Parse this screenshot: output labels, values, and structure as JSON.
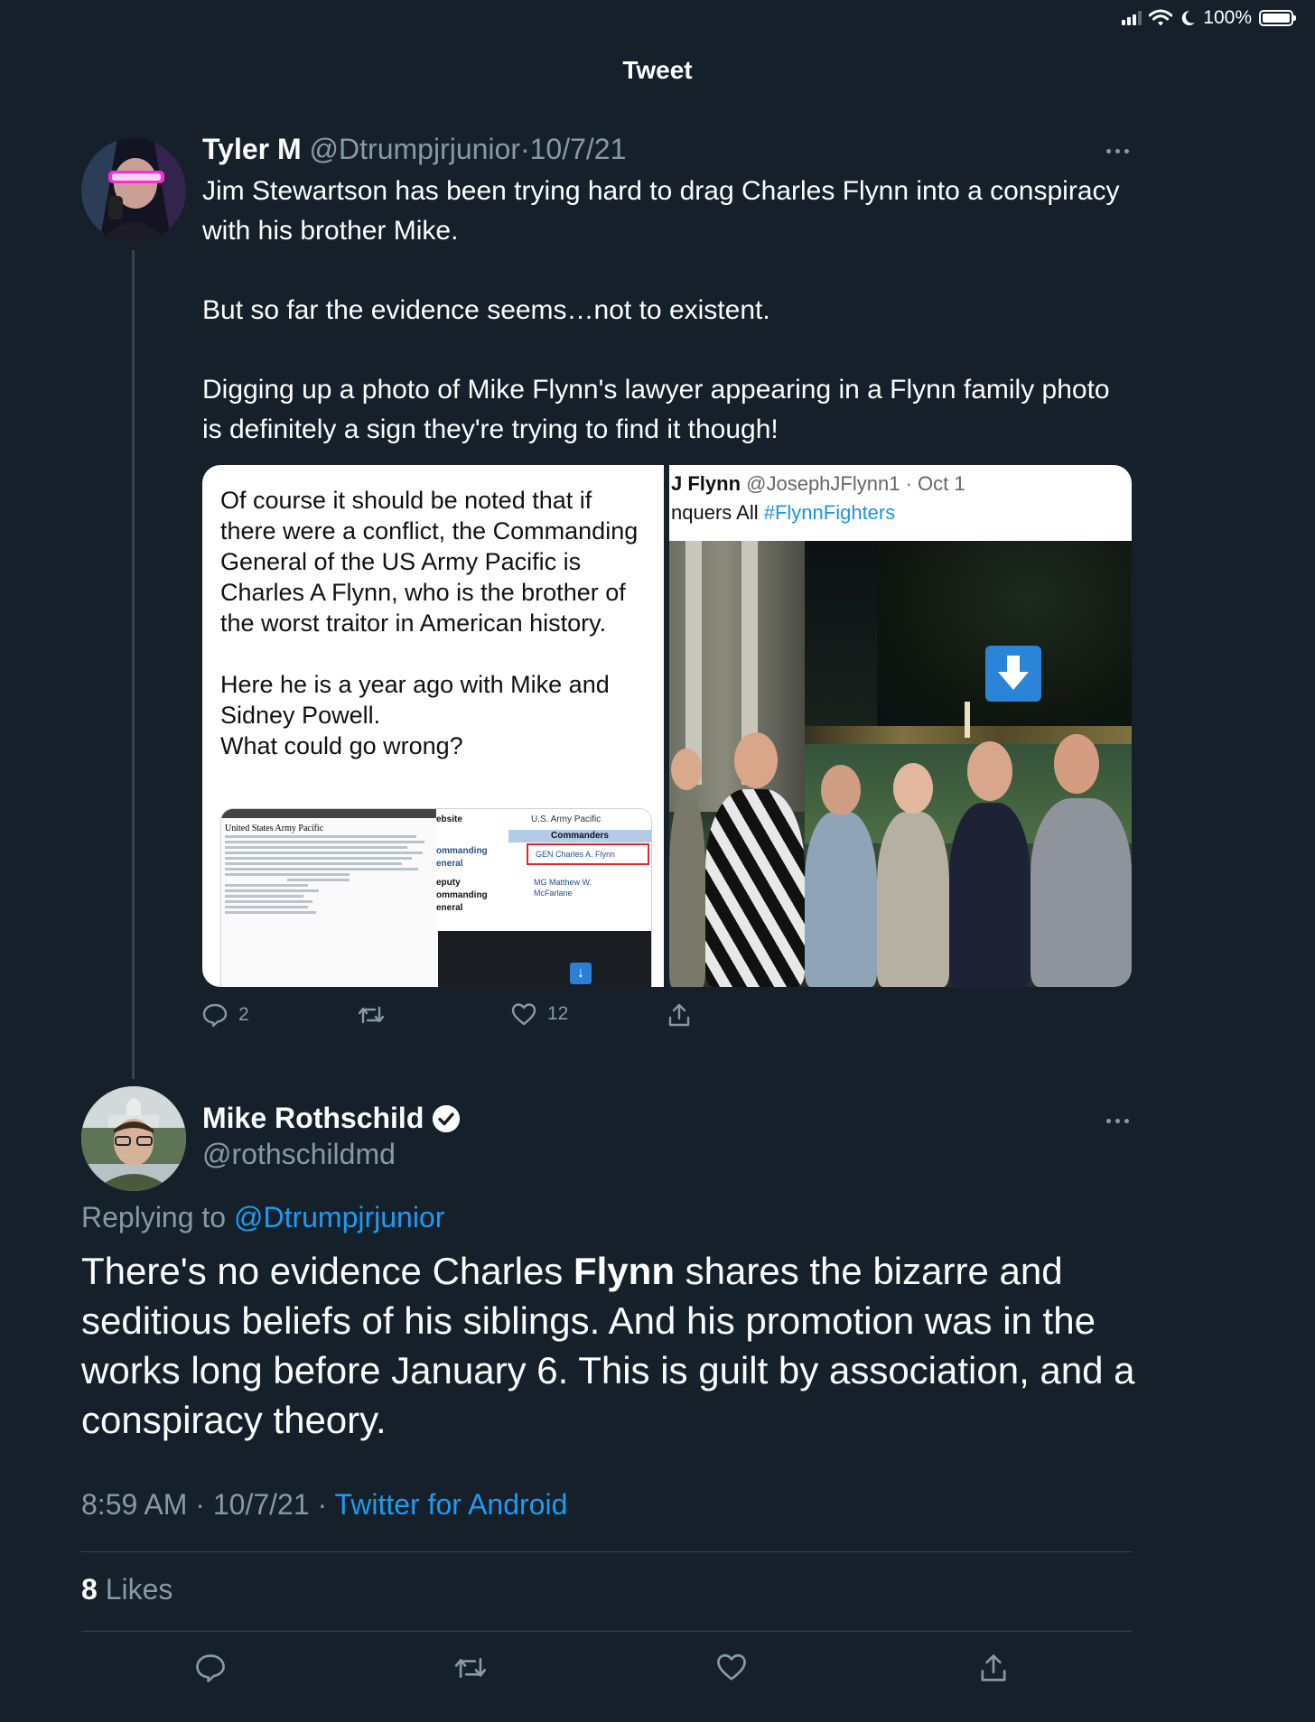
{
  "status_bar": {
    "battery_text": "100%",
    "icons": [
      "signal-icon",
      "wifi-icon",
      "moon-icon",
      "battery-icon"
    ]
  },
  "header": {
    "title": "Tweet"
  },
  "quoted_tweet": {
    "name": "Tyler M",
    "handle": "@Dtrumpjrjunior",
    "separator": "·",
    "date": "10/7/21",
    "paragraphs": [
      "Jim Stewartson has been trying hard to drag Charles Flynn into a conspiracy with his brother Mike.",
      "But so far the evidence seems…not to existent.",
      "Digging up a photo of Mike Flynn's lawyer appearing in a Flynn family photo is definitely a sign they're trying to find it though!"
    ],
    "media": {
      "left_paragraphs": [
        "Of course it should be noted that if there were a conflict, the Commanding General of the US Army Pacific is Charles A Flynn, who is the brother of the worst traitor in American history.",
        "Here he is a year ago with Mike and Sidney Powell.\nWhat could go wrong?"
      ],
      "wiki": {
        "title": "United States Army Pacific",
        "col_a": "ebsite",
        "col_b": "U.S. Army Pacific",
        "commanders": "Commanders",
        "row1_label": "ommanding\neneral",
        "row1_value": "GEN Charles A. Flynn",
        "row2_label": "eputy\nommanding\neneral",
        "row2_value": "MG Matthew W.\nMcFarlane"
      },
      "right_header": {
        "name": "J Flynn",
        "handle": "@JosephJFlynn1",
        "sep": "·",
        "date": "Oct 1",
        "text": "nquers All ",
        "hashtag": "#FlynnFighters"
      }
    },
    "actions": {
      "reply_count": "2",
      "like_count": "12"
    }
  },
  "reply_tweet": {
    "name": "Mike Rothschild",
    "handle": "@rothschildmd",
    "replying_prefix": "Replying to ",
    "replying_to": "@Dtrumpjrjunior",
    "body_before": "There's no evidence Charles ",
    "body_bold": "Flynn",
    "body_after": " shares the bizarre and seditious beliefs of his siblings. And his promotion was in the works long before January 6. This is guilt by association, and a conspiracy theory.",
    "time": "8:59 AM",
    "sep": "·",
    "date": "10/7/21",
    "source": "Twitter for Android",
    "likes_count": "8",
    "likes_label": "Likes"
  },
  "colors": {
    "background": "#15202b",
    "muted": "#8899a6",
    "link": "#1d9bf0",
    "divider": "#38444d"
  }
}
